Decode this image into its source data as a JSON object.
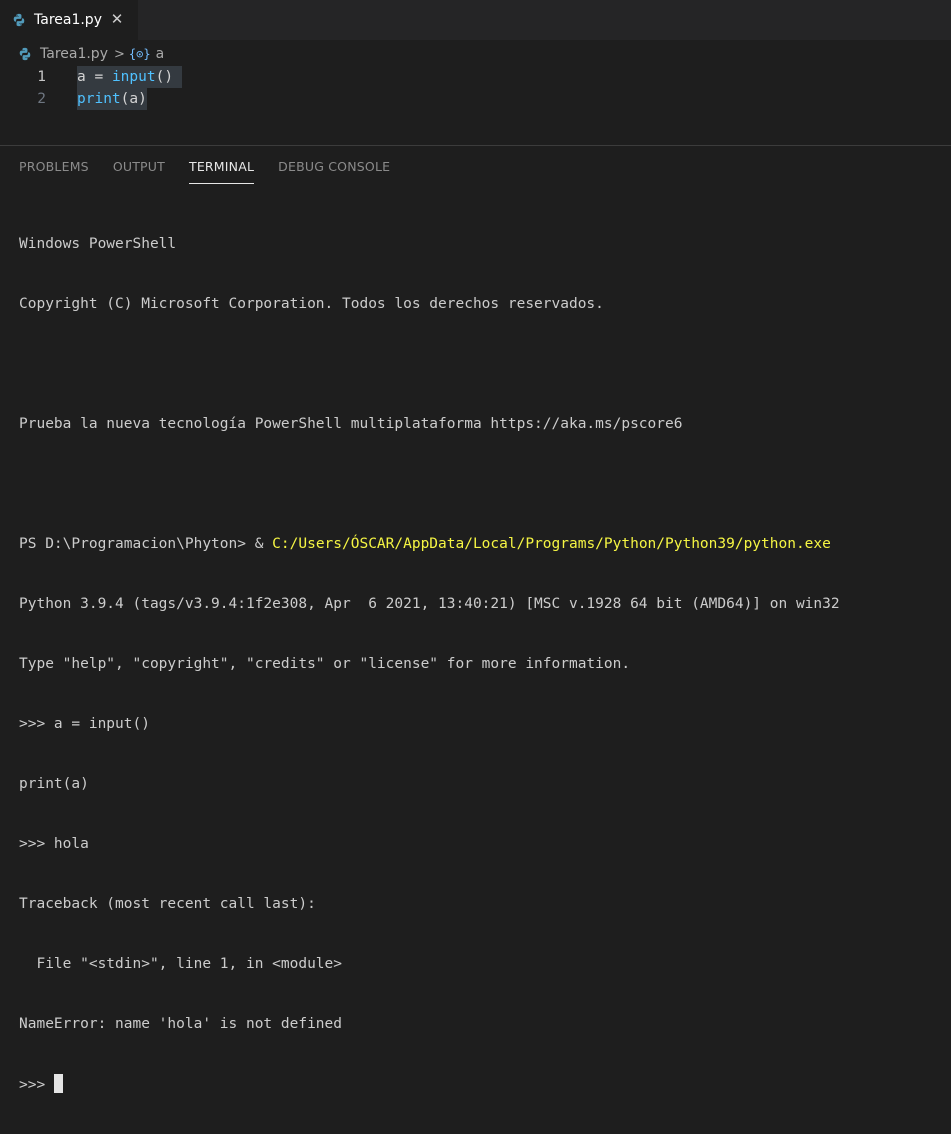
{
  "tab": {
    "label": "Tarea1.py",
    "close_glyph": "✕"
  },
  "breadcrumb": {
    "file": "Tarea1.py",
    "separator": ">",
    "symbol_icon_glyph": "{⊙}",
    "symbol": "a"
  },
  "editor": {
    "lines": [
      {
        "num": "1",
        "tokens": {
          "var": "a",
          "op": " = ",
          "fn": "input",
          "paren": "()"
        }
      },
      {
        "num": "2",
        "tokens": {
          "fn": "print",
          "open": "(",
          "arg": "a",
          "close": ")"
        }
      }
    ]
  },
  "panel": {
    "tabs": [
      "PROBLEMS",
      "OUTPUT",
      "TERMINAL",
      "DEBUG CONSOLE"
    ],
    "active_tab": "TERMINAL"
  },
  "terminal": {
    "lines": [
      "Windows PowerShell",
      "Copyright (C) Microsoft Corporation. Todos los derechos reservados.",
      "",
      "Prueba la nueva tecnología PowerShell multiplataforma https://aka.ms/pscore6",
      "",
      "PS D:\\Programacion\\Phyton> & ",
      "Python 3.9.4 (tags/v3.9.4:1f2e308, Apr  6 2021, 13:40:21) [MSC v.1928 64 bit (AMD64)] on win32",
      "Type \"help\", \"copyright\", \"credits\" or \"license\" for more information.",
      ">>> a = input()",
      "print(a)",
      ">>> hola",
      "Traceback (most recent call last):",
      "  File \"<stdin>\", line 1, in <module>",
      "NameError: name 'hola' is not defined",
      ">>> "
    ],
    "command_path": "C:/Users/ÓSCAR/AppData/Local/Programs/Python/Python39/python.exe"
  },
  "colors": {
    "background": "#1e1e1e",
    "tabbar": "#252526",
    "command_yellow": "#f5f543",
    "function_blue": "#4fc1ff",
    "variable_blue": "#9cdcfe"
  }
}
